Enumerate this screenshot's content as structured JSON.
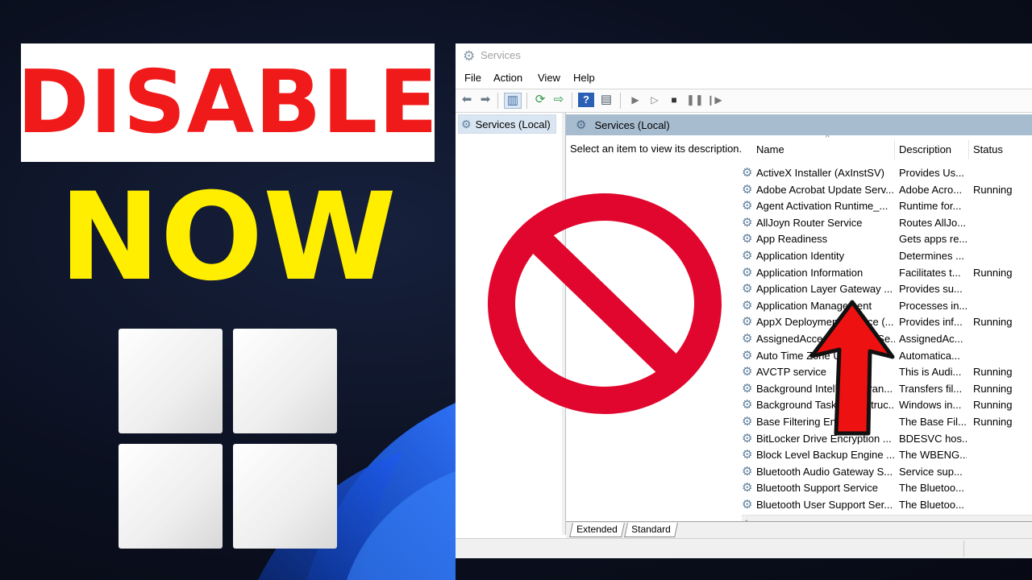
{
  "thumbnail": {
    "headline_top": "DISABLE",
    "headline_bottom": "NOW",
    "colors": {
      "disable_text": "#f01a1a",
      "now_text": "#ffee00",
      "prohibit": "#e1062d",
      "arrow": "#ee1111"
    }
  },
  "window": {
    "title": "Services",
    "menu": [
      "File",
      "Action",
      "View",
      "Help"
    ],
    "toolbar_icons": [
      "back-icon",
      "forward-icon",
      "show-console-tree-icon",
      "refresh-icon",
      "export-list-icon",
      "help-icon",
      "properties-icon",
      "start-service-icon",
      "start-service-alt-icon",
      "stop-service-icon",
      "pause-service-icon",
      "resume-service-icon"
    ],
    "tree_item": "Services (Local)",
    "pane_header": "Services (Local)",
    "description_prompt": "Select an item to view its description.",
    "columns": {
      "name": "Name",
      "description": "Description",
      "status": "Status"
    },
    "services": [
      {
        "name": "ActiveX Installer (AxInstSV)",
        "description": "Provides Us...",
        "status": ""
      },
      {
        "name": "Adobe Acrobat Update Serv...",
        "description": "Adobe Acro...",
        "status": "Running"
      },
      {
        "name": "Agent Activation Runtime_...",
        "description": "Runtime for...",
        "status": ""
      },
      {
        "name": "AllJoyn Router Service",
        "description": "Routes AllJo...",
        "status": ""
      },
      {
        "name": "App Readiness",
        "description": "Gets apps re...",
        "status": ""
      },
      {
        "name": "Application Identity",
        "description": "Determines ...",
        "status": ""
      },
      {
        "name": "Application Information",
        "description": "Facilitates t...",
        "status": "Running"
      },
      {
        "name": "Application Layer Gateway ...",
        "description": "Provides su...",
        "status": ""
      },
      {
        "name": "Application Management",
        "description": "Processes in...",
        "status": ""
      },
      {
        "name": "AppX Deployment Service (...",
        "description": "Provides inf...",
        "status": "Running"
      },
      {
        "name": "AssignedAccessManager Se...",
        "description": "AssignedAc...",
        "status": ""
      },
      {
        "name": "Auto Time Zone Updater",
        "description": "Automatica...",
        "status": ""
      },
      {
        "name": "AVCTP service",
        "description": "This is Audi...",
        "status": "Running"
      },
      {
        "name": "Background Intelligent Tran...",
        "description": "Transfers fil...",
        "status": "Running"
      },
      {
        "name": "Background Tasks Infrastruc...",
        "description": "Windows in...",
        "status": "Running"
      },
      {
        "name": "Base Filtering Engine",
        "description": "The Base Fil...",
        "status": "Running"
      },
      {
        "name": "BitLocker Drive Encryption ...",
        "description": "BDESVC hos...",
        "status": ""
      },
      {
        "name": "Block Level Backup Engine ...",
        "description": "The WBENG...",
        "status": ""
      },
      {
        "name": "Bluetooth Audio Gateway S...",
        "description": "Service sup...",
        "status": ""
      },
      {
        "name": "Bluetooth Support Service",
        "description": "The Bluetoo...",
        "status": ""
      },
      {
        "name": "Bluetooth User Support Ser...",
        "description": "The Bluetoo...",
        "status": ""
      }
    ],
    "tabs": [
      "Extended",
      "Standard"
    ]
  }
}
